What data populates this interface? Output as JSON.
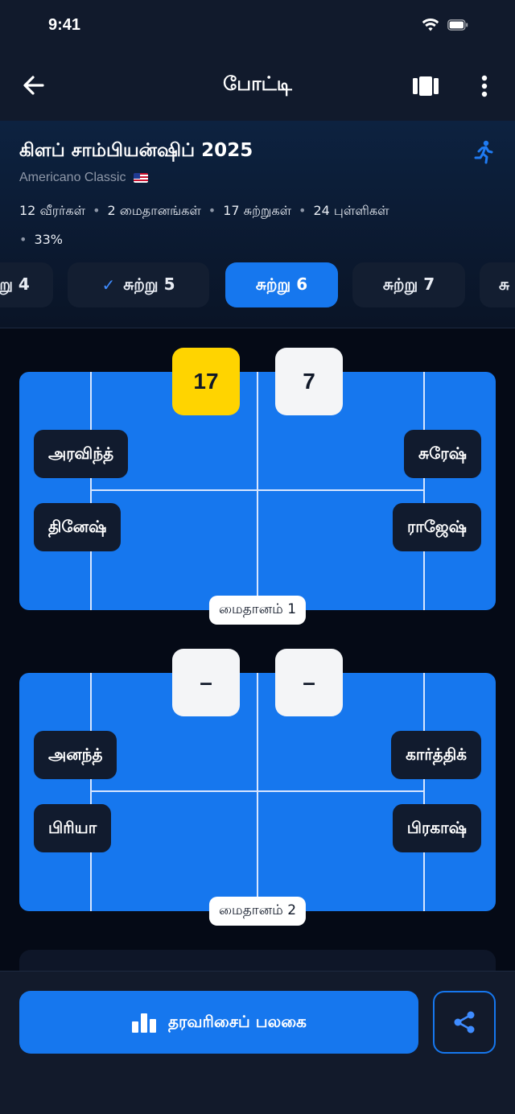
{
  "status_bar": {
    "time": "9:41"
  },
  "nav": {
    "title": "போட்டி"
  },
  "tournament": {
    "title": "கிளப் சாம்பியன்ஷிப் 2025",
    "format": "Americano Classic",
    "stats": [
      "12 வீரர்கள்",
      "2 மைதானங்கள்",
      "17 சுற்றுகள்",
      "24 புள்ளிகள்",
      "33%"
    ]
  },
  "rounds": [
    {
      "label": "று 4",
      "state": "normal"
    },
    {
      "label": "சுற்று 5",
      "state": "completed"
    },
    {
      "label": "சுற்று 6",
      "state": "active"
    },
    {
      "label": "சுற்று 7",
      "state": "normal"
    },
    {
      "label": "சு",
      "state": "normal"
    }
  ],
  "courts": [
    {
      "label": "மைதானம் 1",
      "score_left": "17",
      "score_right": "7",
      "left_players": [
        "அரவிந்த்",
        "தினேஷ்"
      ],
      "right_players": [
        "சுரேஷ்",
        "ராஜேஷ்"
      ]
    },
    {
      "label": "மைதானம் 2",
      "score_left": "–",
      "score_right": "–",
      "left_players": [
        "அனந்த்",
        "பிரியா"
      ],
      "right_players": [
        "கார்த்திக்",
        "பிரகாஷ்"
      ]
    }
  ],
  "bottom": {
    "leaderboard_label": "தரவரிசைப் பலகை"
  },
  "colors": {
    "accent": "#1677ee",
    "winner_score": "#ffd400",
    "background": "#050a16"
  }
}
